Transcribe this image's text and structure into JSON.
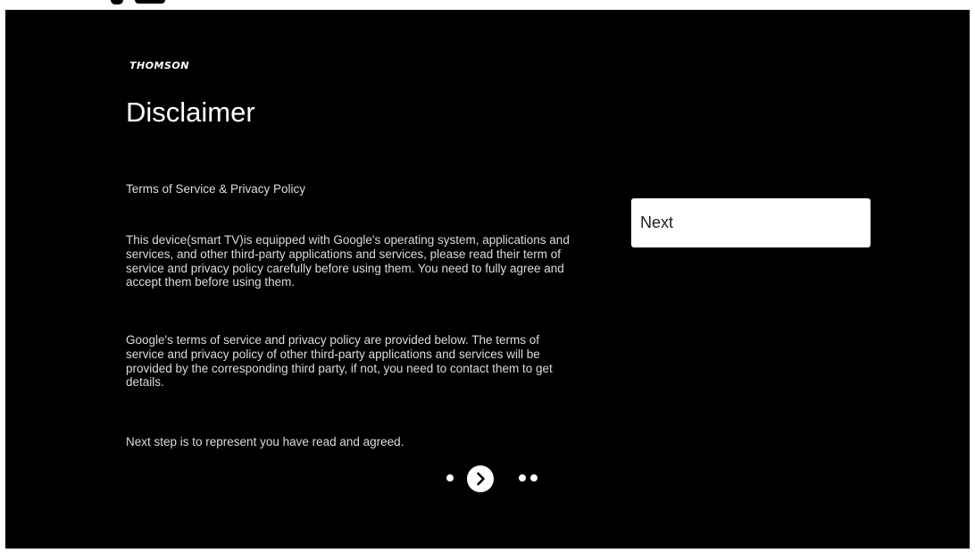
{
  "brand": {
    "logo_text": "THOMSON"
  },
  "header": {
    "title": "Disclaimer"
  },
  "content": {
    "section_heading": "Terms of Service & Privacy Policy",
    "paragraphs": [
      " This device(smart TV)is equipped with Google's operating system, applications and services, and other third-party applications and services, please read their term of service and privacy policy carefully before using them. You need to fully agree and accept them before using them.",
      " Google's terms of service and privacy policy are provided below. The terms of service and privacy policy of other third-party applications and services will be provided by the corresponding third party, if not, you need to contact them to get details.",
      "Next step is to represent you have read and agreed."
    ]
  },
  "actions": {
    "next_label": "Next"
  },
  "pager": {
    "icon": "chevron-right-icon",
    "current_page": 2,
    "total_pages": 4
  },
  "colors": {
    "background": "#000000",
    "text": "#dcdcdc",
    "button_bg": "#ffffff",
    "button_text": "#202124"
  }
}
